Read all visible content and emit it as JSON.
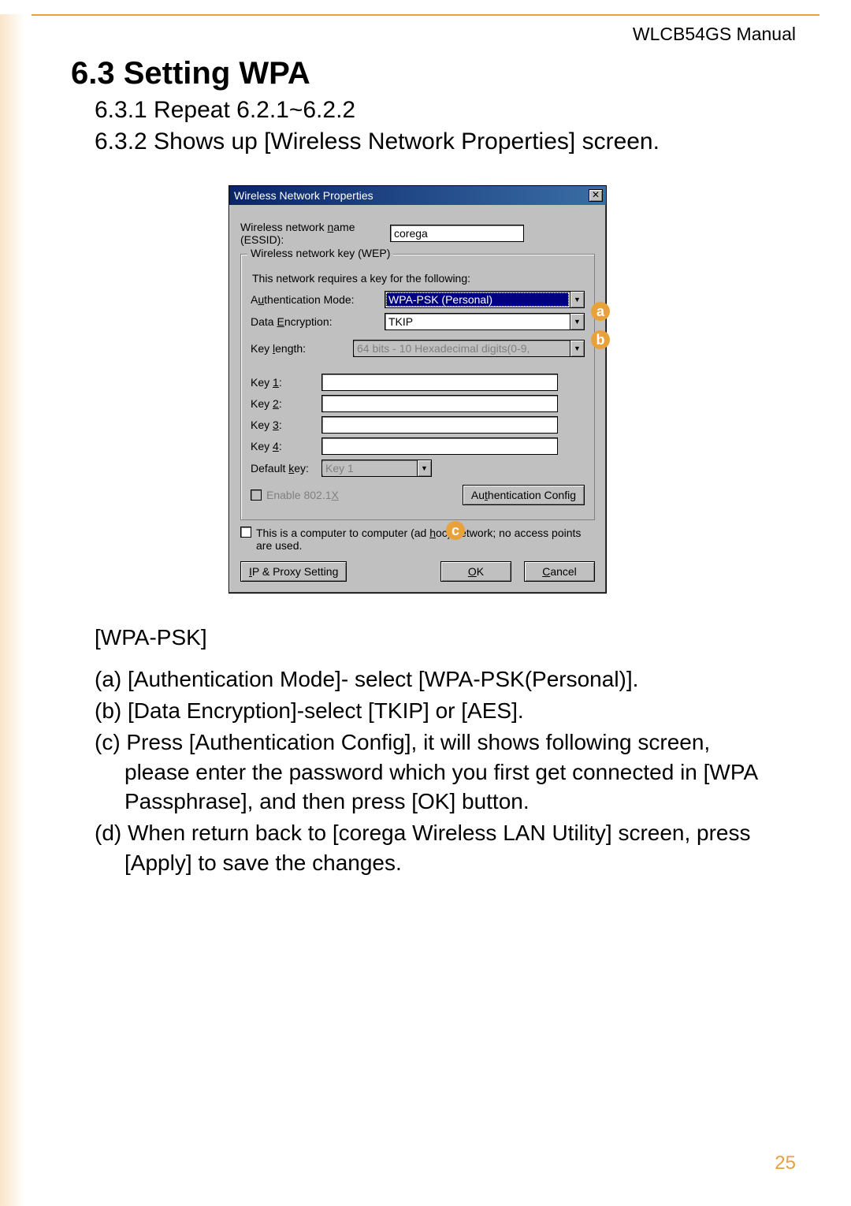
{
  "header": {
    "manual": "WLCB54GS Manual"
  },
  "section": {
    "title": "6.3 Setting WPA",
    "sub1": "6.3.1 Repeat 6.2.1~6.2.2",
    "sub2": "6.3.2 Shows up [Wireless Network Properties] screen."
  },
  "dialog": {
    "title": "Wireless Network Properties",
    "essid_label": "Wireless network name (ESSID):",
    "essid_value": "corega",
    "wep_legend": "Wireless network key (WEP)",
    "wep_note": "This network requires a key for the following:",
    "auth_label": "Authentication Mode:",
    "auth_value": "WPA-PSK (Personal)",
    "enc_label": "Data Encryption:",
    "enc_value": "TKIP",
    "keylen_label": "Key length:",
    "keylen_value": "64 bits - 10 Hexadecimal digits(0-9,",
    "key1": "Key 1:",
    "key2": "Key 2:",
    "key3": "Key 3:",
    "key4": "Key 4:",
    "defkey_label": "Default key:",
    "defkey_value": "Key 1",
    "enable8021x": "Enable 802.1X",
    "authcfg_btn": "Authentication Config",
    "adhoc": "This is a computer to computer (ad hoc) network; no access points are used.",
    "ipproxy_btn": "IP & Proxy Setting",
    "ok_btn": "OK",
    "cancel_btn": "Cancel"
  },
  "callouts": {
    "a": "a",
    "b": "b",
    "c": "c"
  },
  "wpa": {
    "label": "[WPA-PSK]",
    "a": "(a) [Authentication Mode]- select [WPA-PSK(Personal)].",
    "b": "(b) [Data Encryption]-select [TKIP] or [AES].",
    "c": "(c) Press [Authentication Config], it will shows following screen, please enter the password which you first get connected in [WPA Passphrase], and then press [OK] button.",
    "d": "(d) When return back to [corega Wireless LAN Utility] screen, press [Apply] to save the changes."
  },
  "page": "25"
}
